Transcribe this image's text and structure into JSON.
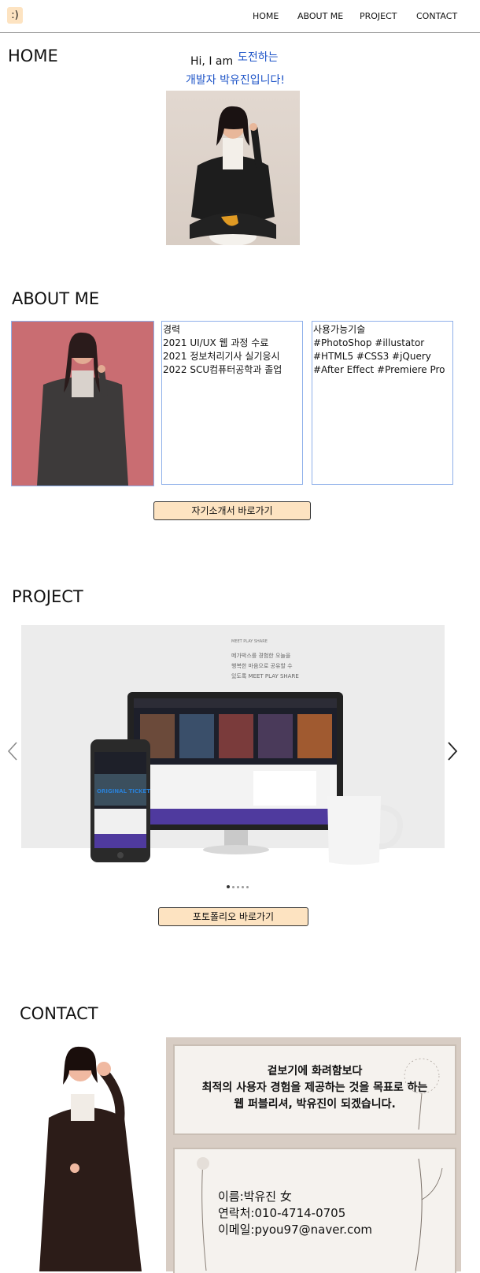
{
  "header": {
    "logo_text": ":)",
    "nav": [
      "HOME",
      "ABOUT ME",
      "PROJECT",
      "CONTACT"
    ]
  },
  "home": {
    "title": "HOME",
    "greeting": "Hi, I am",
    "highlight": "도전하는",
    "tagline": "개발자 박유진입니다!"
  },
  "about": {
    "title": "ABOUT ME",
    "career_title": "경력",
    "career": [
      "2021 UI/UX 웹 과정 수료",
      "2021 정보처리기사 실기응시",
      "2022 SCU컴퓨터공학과 졸업"
    ],
    "skills_title": "사용가능기술",
    "skills": [
      "#PhotoShop #illustator",
      "#HTML5 #CSS3 #jQuery",
      "#After Effect #Premiere Pro"
    ],
    "button": "자기소개서 바로가기"
  },
  "project": {
    "title": "PROJECT",
    "slide_text": [
      "MEET PLAY SHARE",
      "메가박스를 경험한 오늘을",
      "행복한 마음으로 공유할 수",
      "있도록 MEET PLAY SHARE"
    ],
    "phone_text": "ORIGINAL TICKET",
    "dots_count": 5,
    "active_dot": 0,
    "button": "포토폴리오 바로가기"
  },
  "contact": {
    "title": "CONTACT",
    "message": [
      "겉보기에 화려함보다",
      "최적의 사용자 경험을 제공하는 것을 목표로 하는",
      "웹 퍼블리셔, 박유진이 되겠습니다."
    ],
    "name": "이름:박유진 女",
    "phone": "연락처:010-4714-0705",
    "email": "이메일:pyou97@naver.com"
  },
  "colors": {
    "accent_blue": "#1f55c8",
    "button_bg": "#fde3c1",
    "box_border": "#8fb0ea"
  }
}
